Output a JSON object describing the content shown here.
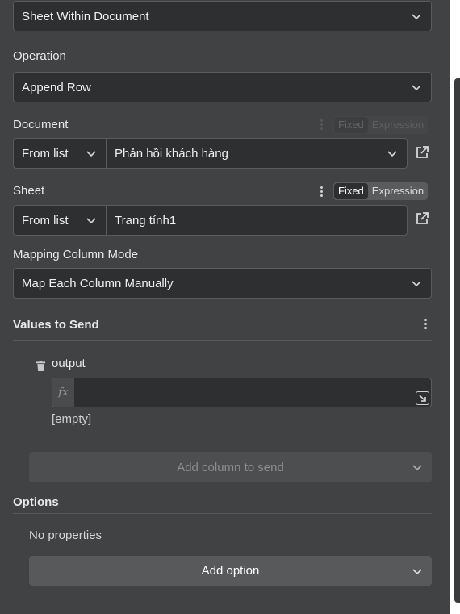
{
  "sheet_scope_select": {
    "value": "Sheet Within Document"
  },
  "operation": {
    "label": "Operation",
    "value": "Append Row"
  },
  "document": {
    "label": "Document",
    "mode_value": "From list",
    "value": "Phản hồi khách hàng",
    "toggle": {
      "fixed": "Fixed",
      "expression": "Expression"
    }
  },
  "sheet": {
    "label": "Sheet",
    "mode_value": "From list",
    "value": "Trang tính1",
    "toggle": {
      "fixed": "Fixed",
      "expression": "Expression"
    }
  },
  "mapping": {
    "label": "Mapping Column Mode",
    "value": "Map Each Column Manually"
  },
  "values_to_send": {
    "label": "Values to Send",
    "field_name": "output",
    "fx_tag": "fx",
    "empty_hint": "[empty]",
    "add_column_label": "Add column to send"
  },
  "options": {
    "label": "Options",
    "empty_text": "No properties",
    "add_option_label": "Add option"
  }
}
